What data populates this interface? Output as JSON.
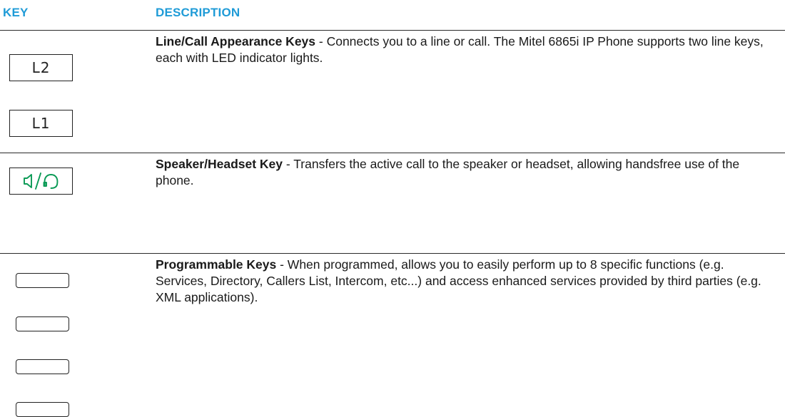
{
  "header": {
    "key_label": "KEY",
    "description_label": "DESCRIPTION"
  },
  "colors": {
    "header_blue": "#1f9bd7",
    "speaker_icon_green": "#0a9a55",
    "text": "#1a1a1a",
    "rule": "#2a2a2a"
  },
  "rows": [
    {
      "keys": [
        "L2",
        "L1"
      ],
      "title": "Line/Call Appearance Keys",
      "text": " - Connects you to a line or call. The Mitel 6865i IP Phone supports two line keys, each with LED indicator lights."
    },
    {
      "icon": "speaker-headset-icon",
      "title": "Speaker/Headset Key",
      "text": " - Transfers the active call to the speaker or headset, allowing handsfree use of the phone."
    },
    {
      "icon": "programmable-key-icon",
      "title": "Programmable Keys",
      "text": " - When programmed, allows you to easily perform up to 8 specific functions (e.g. Services, Directory, Callers List, Intercom, etc...) and access enhanced services provided by third parties (e.g. XML applications)."
    }
  ]
}
